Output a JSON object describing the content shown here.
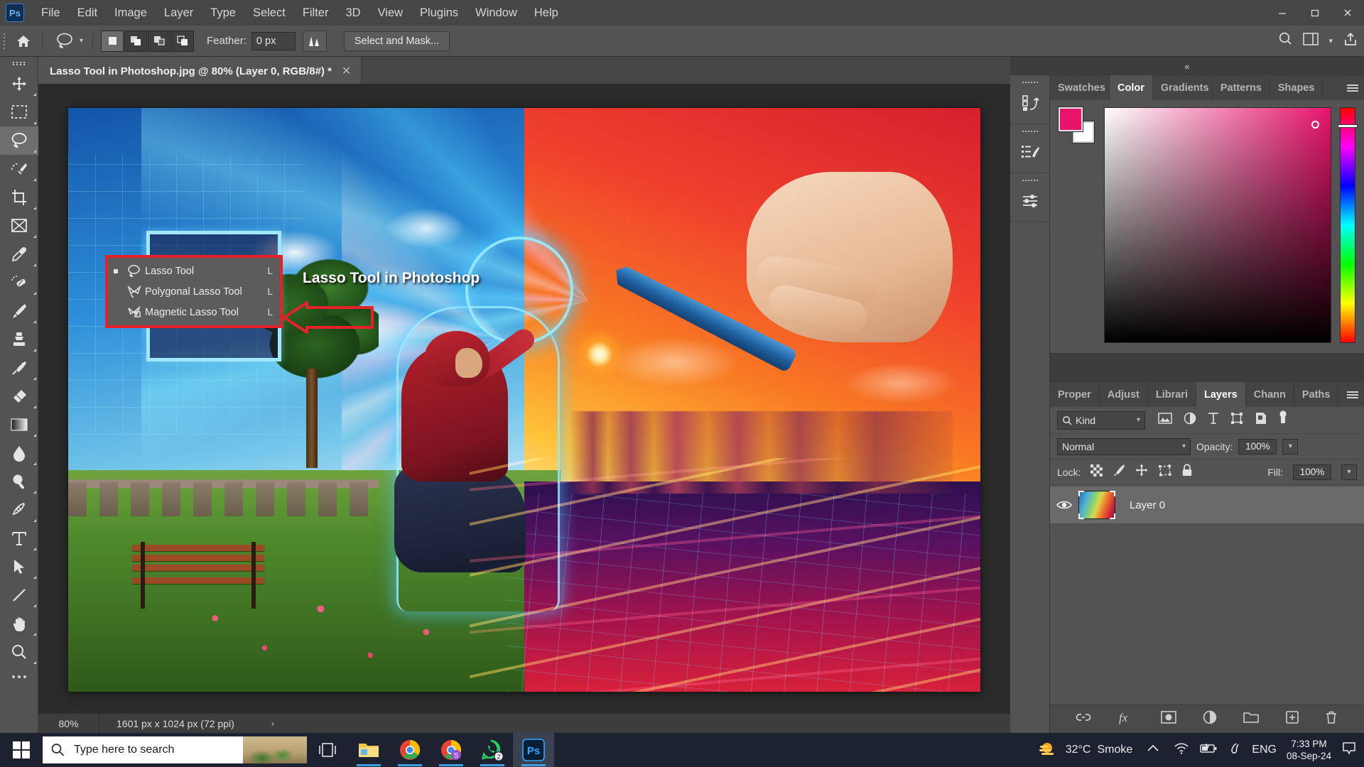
{
  "menubar": {
    "app_icon": "photoshop-logo",
    "items": [
      "File",
      "Edit",
      "Image",
      "Layer",
      "Type",
      "Select",
      "Filter",
      "3D",
      "View",
      "Plugins",
      "Window",
      "Help"
    ],
    "window_controls": {
      "minimize": "—",
      "maximize": "□",
      "close": "✕"
    }
  },
  "options_bar": {
    "home_icon": "home-icon",
    "tool_icon": "lasso-tool-icon",
    "tool_dropdown_icon": "chevron-down-icon",
    "selection_modes": [
      "new-selection",
      "add-to-selection",
      "subtract-from-selection",
      "intersect-with-selection"
    ],
    "feather_label": "Feather:",
    "feather_value": "0 px",
    "antialias_icon": "anti-alias-icon",
    "select_and_mask_label": "Select and Mask...",
    "search_icon": "search-icon",
    "workspace_icon": "workspace-icon",
    "workspace_chevron": "chevron-down-icon",
    "share_icon": "share-icon"
  },
  "toolbar": {
    "tools": [
      {
        "name": "move-tool",
        "icon": "move"
      },
      {
        "name": "rectangular-marquee-tool",
        "icon": "marquee"
      },
      {
        "name": "lasso-tool",
        "icon": "lasso",
        "active": true
      },
      {
        "name": "object-selection-tool",
        "icon": "quick-select"
      },
      {
        "name": "crop-tool",
        "icon": "crop"
      },
      {
        "name": "frame-tool",
        "icon": "frame"
      },
      {
        "name": "eyedropper-tool",
        "icon": "eyedropper"
      },
      {
        "name": "spot-healing-brush-tool",
        "icon": "healing"
      },
      {
        "name": "brush-tool",
        "icon": "brush"
      },
      {
        "name": "clone-stamp-tool",
        "icon": "stamp"
      },
      {
        "name": "history-brush-tool",
        "icon": "history-brush"
      },
      {
        "name": "eraser-tool",
        "icon": "eraser"
      },
      {
        "name": "gradient-tool",
        "icon": "gradient"
      },
      {
        "name": "blur-tool",
        "icon": "blur"
      },
      {
        "name": "dodge-tool",
        "icon": "dodge"
      },
      {
        "name": "pen-tool",
        "icon": "pen"
      },
      {
        "name": "horizontal-type-tool",
        "icon": "type"
      },
      {
        "name": "path-selection-tool",
        "icon": "path-select"
      },
      {
        "name": "line-tool",
        "icon": "line"
      },
      {
        "name": "hand-tool",
        "icon": "hand"
      },
      {
        "name": "zoom-tool",
        "icon": "zoom"
      },
      {
        "name": "edit-toolbar",
        "icon": "more-dots"
      }
    ]
  },
  "document": {
    "tab_title": "Lasso Tool in Photoshop.jpg @ 80% (Layer 0, RGB/8#) *",
    "close_icon": "close-icon",
    "status": {
      "zoom": "80%",
      "dimensions": "1601 px x 1024 px (72 ppi)",
      "expand_icon": "chevron-right-icon"
    }
  },
  "flyout_menu": {
    "items": [
      {
        "label": "Lasso Tool",
        "shortcut": "L",
        "icon": "lasso-icon",
        "selected": true
      },
      {
        "label": "Polygonal Lasso Tool",
        "shortcut": "L",
        "icon": "polygonal-lasso-icon",
        "selected": false
      },
      {
        "label": "Magnetic Lasso Tool",
        "shortcut": "L",
        "icon": "magnetic-lasso-icon",
        "selected": false
      }
    ],
    "highlight_color": "#e8202a"
  },
  "annotation": {
    "caption": "Lasso Tool in Photoshop",
    "arrow_color": "#e8202a",
    "arrow_direction": "left"
  },
  "right_panels": {
    "collapse_icon": "collapse-panels-icon",
    "icon_column": [
      {
        "name": "history-panel-icon"
      },
      {
        "name": "actions-panel-icon"
      },
      {
        "name": "adjustments-panel-icon"
      }
    ],
    "color_group": {
      "tabs": [
        {
          "label": "Swatches",
          "active": false
        },
        {
          "label": "Color",
          "active": true
        },
        {
          "label": "Gradients",
          "active": false
        },
        {
          "label": "Patterns",
          "active": false
        },
        {
          "label": "Shapes",
          "active": false
        }
      ],
      "menu_icon": "panel-menu-icon",
      "foreground_color": "#e8146b",
      "background_color": "#ffffff"
    },
    "layers_group": {
      "tabs": [
        {
          "label": "Proper",
          "active": false
        },
        {
          "label": "Adjust",
          "active": false
        },
        {
          "label": "Librari",
          "active": false
        },
        {
          "label": "Layers",
          "active": true
        },
        {
          "label": "Chann",
          "active": false
        },
        {
          "label": "Paths",
          "active": false
        }
      ],
      "menu_icon": "panel-menu-icon",
      "filter": {
        "search_icon": "search-icon",
        "kind_label": "Kind",
        "chevron": "chevron-down-icon",
        "filter_icons": [
          "pixel-layers-filter",
          "adjustment-layers-filter",
          "type-layers-filter",
          "shape-layers-filter",
          "smart-object-filter",
          "filter-toggle"
        ]
      },
      "blend_mode": "Normal",
      "opacity_label": "Opacity:",
      "opacity_value": "100%",
      "lock_label": "Lock:",
      "lock_icons": [
        "lock-transparent-pixels",
        "lock-image-pixels",
        "lock-position",
        "lock-artboard-nesting",
        "lock-all"
      ],
      "fill_label": "Fill:",
      "fill_value": "100%",
      "layers": [
        {
          "name": "Layer 0",
          "visible": true,
          "selected": true,
          "thumbnail": "layer-thumbnail"
        }
      ],
      "footer_icons": [
        "link-layers",
        "layer-style-fx",
        "add-layer-mask",
        "new-adjustment-layer",
        "new-group",
        "new-layer",
        "delete-layer"
      ]
    }
  },
  "taskbar": {
    "start_icon": "windows-start-icon",
    "search_placeholder": "Type here to search",
    "search_icon": "search-icon",
    "task_view_icon": "task-view-icon",
    "apps": [
      {
        "name": "file-explorer",
        "running": true,
        "badge": null
      },
      {
        "name": "google-chrome",
        "running": true,
        "badge": null
      },
      {
        "name": "google-chrome-profile",
        "running": true,
        "badge": null
      },
      {
        "name": "whatsapp",
        "running": true,
        "badge": "2"
      },
      {
        "name": "adobe-photoshop",
        "running": true,
        "active": true,
        "badge": null
      }
    ],
    "tray": {
      "weather_icon": "sun-cloud-icon",
      "temperature": "32°C",
      "condition": "Smoke",
      "show_hidden_icon": "chevron-up-icon",
      "network_icon": "wifi-icon",
      "battery_icon": "battery-charging-icon",
      "sound_icon": "sound-icon",
      "language": "ENG",
      "time": "7:33 PM",
      "date": "08-Sep-24",
      "notification_icon": "notification-icon"
    }
  }
}
